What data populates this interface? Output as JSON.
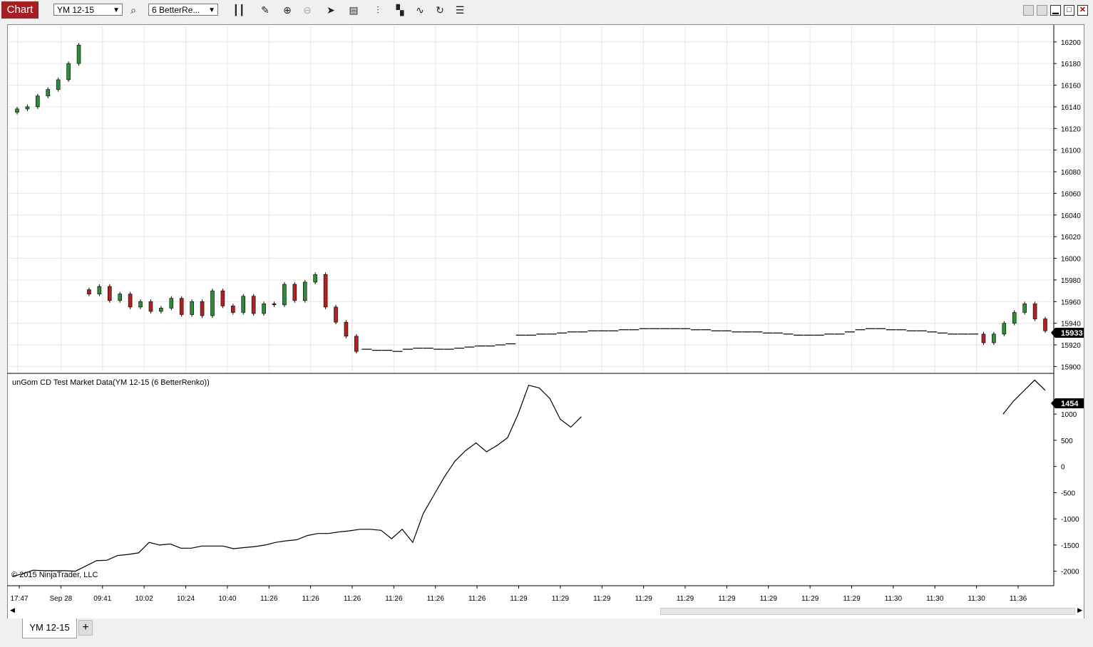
{
  "toolbar": {
    "chart_label": "Chart",
    "instrument": "YM 12-15",
    "bar_type": "6 BetterRe...",
    "icons": [
      "search-icon",
      "bar-style-icon",
      "pencil-icon",
      "zoom-in-icon",
      "zoom-out-icon",
      "pointer-icon",
      "data-box-icon",
      "properties-icon",
      "strategies-icon",
      "indicators-icon",
      "reload-icon",
      "list-icon"
    ]
  },
  "window": {
    "buttons": [
      "min",
      "max",
      "restore",
      "close"
    ]
  },
  "price_panel": {
    "y_labels": [
      "16200",
      "16180",
      "16160",
      "16140",
      "16120",
      "16100",
      "16080",
      "16060",
      "16040",
      "16020",
      "16000",
      "15980",
      "15960",
      "15940",
      "15920",
      "15900"
    ],
    "last_price": "15933",
    "colors": {
      "up": "#2e8b3a",
      "down": "#b22222",
      "marker": "#000000"
    }
  },
  "indicator_panel": {
    "title": "unGom CD Test Market Data(YM 12-15 (6 BetterRenko))",
    "y_labels": [
      "1000",
      "500",
      "0",
      "-500",
      "-1000",
      "-1500",
      "-2000"
    ],
    "last_value": "1454",
    "copyright": "© 2015 NinjaTrader, LLC"
  },
  "x_axis": {
    "labels": [
      "17:47",
      "Sep 28",
      "09:41",
      "10:02",
      "10:24",
      "10:40",
      "11:26",
      "11:26",
      "11:26",
      "11:26",
      "11:26",
      "11:26",
      "11:29",
      "11:29",
      "11:29",
      "11:29",
      "11:29",
      "11:29",
      "11:29",
      "11:29",
      "11:29",
      "11:30",
      "11:30",
      "11:30",
      "11:36"
    ]
  },
  "tabs": [
    {
      "label": "YM 12-15"
    }
  ],
  "tab_add": "+",
  "chart_data": {
    "type": "line",
    "title": "",
    "price_series": {
      "ylim": [
        15895,
        16215
      ],
      "x": [
        0,
        1,
        2,
        3,
        4,
        5,
        6,
        7,
        8,
        9,
        10,
        11,
        12,
        13,
        14,
        15,
        16,
        17,
        18,
        19,
        20,
        21,
        22,
        23,
        24,
        25,
        26,
        27,
        28,
        29,
        30,
        31,
        32,
        33,
        34,
        35,
        36,
        37,
        38,
        39,
        40,
        41,
        42,
        43,
        44,
        45,
        46,
        47,
        48,
        49,
        50,
        51,
        52,
        53,
        54,
        55,
        56,
        57,
        58,
        59,
        60,
        61,
        62,
        63,
        64,
        65,
        66,
        67,
        68,
        69,
        70,
        71,
        72,
        73,
        74,
        75,
        76,
        77,
        78,
        79,
        80,
        81,
        82,
        83,
        84,
        85,
        86,
        87,
        88,
        89,
        90,
        91,
        92,
        93,
        94,
        95,
        96,
        97,
        98,
        99,
        100
      ],
      "values": [
        16138,
        16140,
        16150,
        16156,
        16165,
        16180,
        16197,
        15967,
        15974,
        15961,
        15967,
        15955,
        15960,
        15951,
        15954,
        15963,
        15948,
        15960,
        15947,
        15970,
        15956,
        15950,
        15965,
        15949,
        15958,
        15957,
        15976,
        15961,
        15978,
        15985,
        15955,
        15941,
        15928,
        15914,
        15916,
        15915,
        15915,
        15914,
        15916,
        15917,
        15917,
        15916,
        15916,
        15917,
        15918,
        15919,
        15919,
        15920,
        15921,
        15929,
        15929,
        15930,
        15930,
        15931,
        15932,
        15932,
        15933,
        15933,
        15933,
        15934,
        15934,
        15935,
        15935,
        15935,
        15935,
        15935,
        15934,
        15934,
        15933,
        15933,
        15932,
        15932,
        15932,
        15931,
        15931,
        15930,
        15929,
        15929,
        15929,
        15930,
        15930,
        15932,
        15934,
        15935,
        15935,
        15934,
        15934,
        15933,
        15933,
        15932,
        15931,
        15930,
        15930,
        15930,
        15922,
        15930,
        15940,
        15950,
        15958,
        15944,
        15933
      ]
    },
    "indicator_series": {
      "ylim": [
        -2250,
        1750
      ],
      "values": [
        -2100,
        -2050,
        -1980,
        -1990,
        -1990,
        -1990,
        -2000,
        -1900,
        -1800,
        -1790,
        -1700,
        -1680,
        -1650,
        -1450,
        -1500,
        -1480,
        -1560,
        -1560,
        -1520,
        -1520,
        -1520,
        -1570,
        -1550,
        -1530,
        -1500,
        -1450,
        -1420,
        -1400,
        -1320,
        -1280,
        -1280,
        -1250,
        -1230,
        -1200,
        -1200,
        -1220,
        -1380,
        -1200,
        -1450,
        -900,
        -550,
        -200,
        100,
        300,
        450,
        280,
        400,
        550,
        1000,
        1550,
        1500,
        1300,
        900,
        750,
        950,
        null,
        null,
        null,
        null,
        null,
        null,
        null,
        null,
        null,
        null,
        null,
        null,
        null,
        null,
        null,
        null,
        null,
        null,
        null,
        null,
        null,
        null,
        null,
        null,
        null,
        null,
        null,
        null,
        null,
        null,
        null,
        null,
        null,
        null,
        null,
        null,
        null,
        null,
        null,
        1000,
        1250,
        1450,
        1650,
        1454
      ]
    }
  }
}
